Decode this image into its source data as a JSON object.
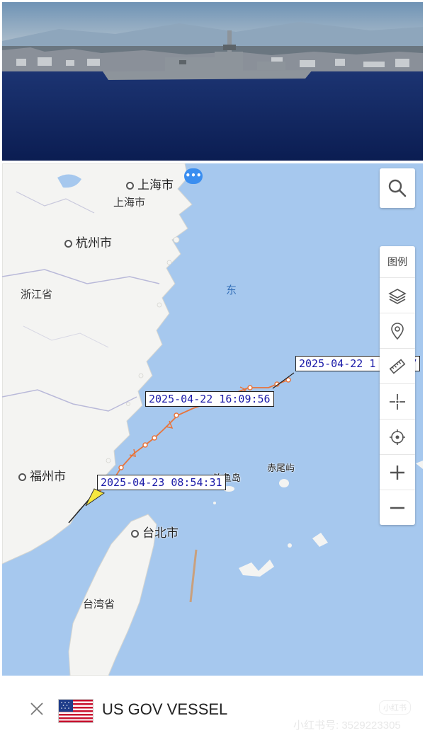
{
  "map": {
    "labels": {
      "shanghai_city": "上海市",
      "shanghai_city_2": "上海市",
      "hangzhou": "杭州市",
      "zhejiang": "浙江省",
      "east_sea": "东",
      "fuzhou": "福州市",
      "diaoyu": "钓鱼岛",
      "chiwei": "赤尾屿",
      "taipei": "台北市",
      "taiwan": "台湾省"
    },
    "track_labels": {
      "start": "2025-04-22 1",
      "start_suffix": "07",
      "mid": "2025-04-22 16:09:56",
      "end": "2025-04-23 08:54:31"
    },
    "track_color": "#e8743b",
    "water_color": "#a6c8ee",
    "land_color": "#f4f4f2"
  },
  "toolbar": {
    "search_icon": "search-icon",
    "legend_label": "图例",
    "buttons": [
      "layers-icon",
      "location-pin-icon",
      "ruler-icon",
      "crosshair-icon",
      "target-icon",
      "zoom-in-icon",
      "zoom-out-icon"
    ]
  },
  "vessel": {
    "name": "US GOV VESSEL",
    "flag": "us-flag-icon"
  },
  "watermark": {
    "logo": "小红书",
    "id": "小红书号: 3529223305"
  }
}
